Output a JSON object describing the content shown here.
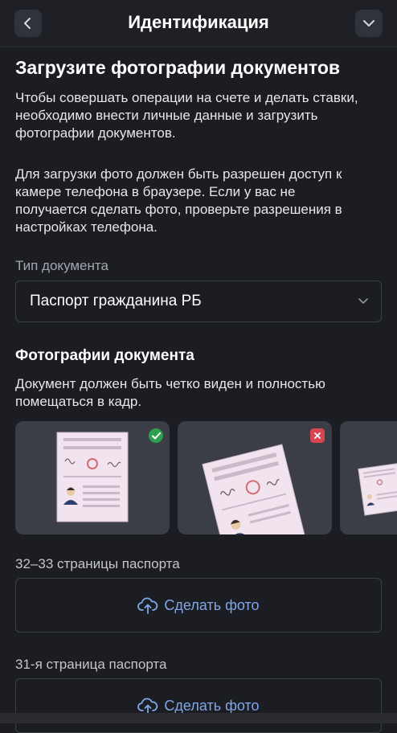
{
  "header": {
    "title": "Идентификация",
    "back_icon": "chevron-left-icon",
    "menu_icon": "chevron-down-icon"
  },
  "main": {
    "heading": "Загрузите фотографии документов",
    "intro_lines": [
      "Чтобы совершать операции на счете и делать ставки,",
      "необходимо внести личные данные и загрузить",
      "фотографии документов."
    ],
    "camera_lines": [
      "Для загрузки фото должен быть разрешен доступ к",
      "камере телефона в браузере. Если у вас не",
      "получается сделать фото, проверьте разрешения в",
      "настройках телефона."
    ],
    "doc_type": {
      "label": "Тип документа",
      "value": "Паспорт гражданина РБ"
    },
    "photos": {
      "title": "Фотографии документа",
      "hint_lines": [
        "Документ должен быть четко виден и полностью",
        "помещаться в кадр."
      ],
      "examples": [
        {
          "status": "correct",
          "icon": "check-icon"
        },
        {
          "status": "wrong",
          "icon": "cross-icon"
        },
        {
          "status": "partial"
        }
      ]
    },
    "uploads": [
      {
        "label": "32–33 страницы паспорта",
        "button": "Сделать фото",
        "icon": "cloud-upload-icon"
      },
      {
        "label": "31-я страница паспорта",
        "button": "Сделать фото",
        "icon": "cloud-upload-icon"
      }
    ]
  },
  "colors": {
    "background": "#1b1d23",
    "accent": "#7ea7e6",
    "success": "#2e9e4f",
    "error": "#d64550"
  }
}
